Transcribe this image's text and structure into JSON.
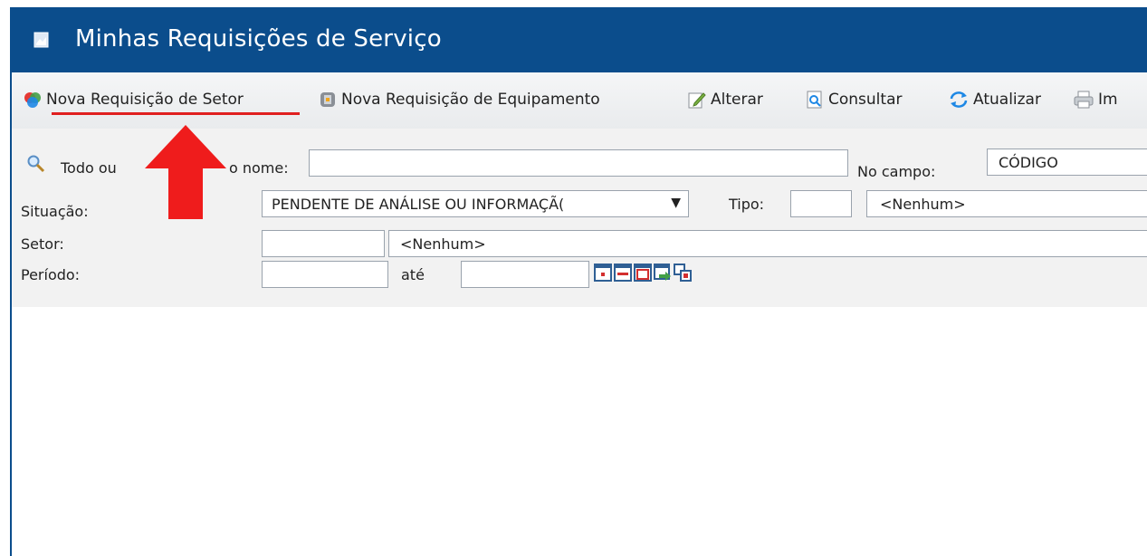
{
  "window": {
    "title": "Minhas Requisições de Serviço"
  },
  "toolbar": {
    "nova_requisicao_setor": "Nova Requisição de Setor",
    "nova_requisicao_equipamento": "Nova Requisição de Equipamento",
    "alterar": "Alterar",
    "consultar": "Consultar",
    "atualizar": "Atualizar",
    "imprimir": "Im"
  },
  "filters": {
    "search_label_start": "Todo ou ",
    "search_label_end": "o nome:",
    "search_value": "",
    "no_campo_label": "No campo:",
    "no_campo_value": "CÓDIGO",
    "situacao_label": "Situação:",
    "situacao_value": "PENDENTE DE ANÁLISE OU INFORMAÇÃ(",
    "tipo_label": "Tipo:",
    "tipo_code": "",
    "tipo_name": "<Nenhum>",
    "setor_label": "Setor:",
    "setor_code": "",
    "setor_name": "<Nenhum>",
    "periodo_label": "Período:",
    "periodo_start": "",
    "ate_label": "até",
    "periodo_end": ""
  },
  "colors": {
    "title_bar": "#0b4d8c",
    "annotation": "#e02020"
  },
  "icons": [
    "document-icon",
    "new-sector-request-icon",
    "new-equipment-request-icon",
    "edit-icon",
    "search-document-icon",
    "refresh-icon",
    "printer-icon",
    "magnifier-icon",
    "date-preset-icons"
  ]
}
